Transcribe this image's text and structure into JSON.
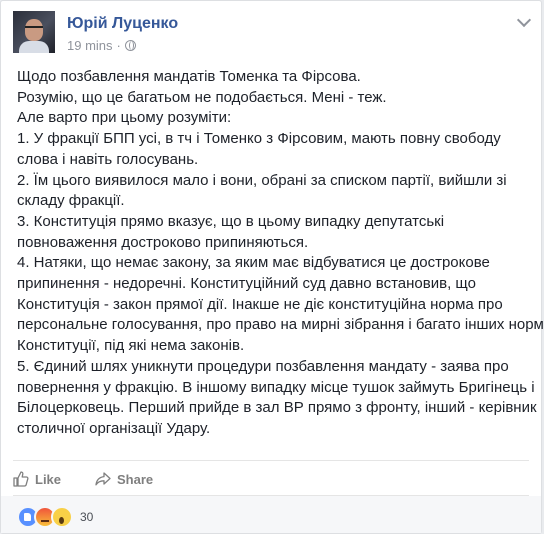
{
  "post": {
    "author": "Юрій Луценко",
    "time": "19 mins",
    "lines": [
      "Щодо позбавлення мандатів Томенка та Фірсова.",
      "Розумію, що це багатьом не подобається. Мені - теж.",
      "Але варто при цьому розуміти:",
      "1. У фракції БПП усі, в тч і Томенко з Фірсовим, мають повну свободу",
      "слова і навіть голосувань.",
      "2. Їм цього виявилося мало і вони, обрані за списком партії, вийшли зі",
      "складу фракції.",
      "3. Конституція прямо вказує, що в цьому випадку депутатські",
      "повноваження достроково припиняються.",
      "4. Натяки, що немає закону, за яким має відбуватися це дострокове",
      "припинення - недоречні. Конституційний суд давно встановив, що",
      "Конституція - закон прямої дії. Інакше не діє конституційна норма про",
      "персональне голосування, про право на мирні зібрання і багато інших норм",
      "Конституції, під які нема законів.",
      "5. Єдиний шлях уникнути процедури позбавлення мандату - заява про",
      "повернення у фракцію. В іншому випадку місце тушок займуть Бригінець і",
      "Білоцерковець. Перший прийде в зал ВР прямо з фронту, інший - керівник",
      "столичної організації Удару."
    ]
  },
  "actions": {
    "like": "Like",
    "share": "Share"
  },
  "reactions": {
    "count": "30"
  },
  "colors": {
    "link": "#365899",
    "secondary": "#90949c",
    "text": "#1d2129"
  }
}
